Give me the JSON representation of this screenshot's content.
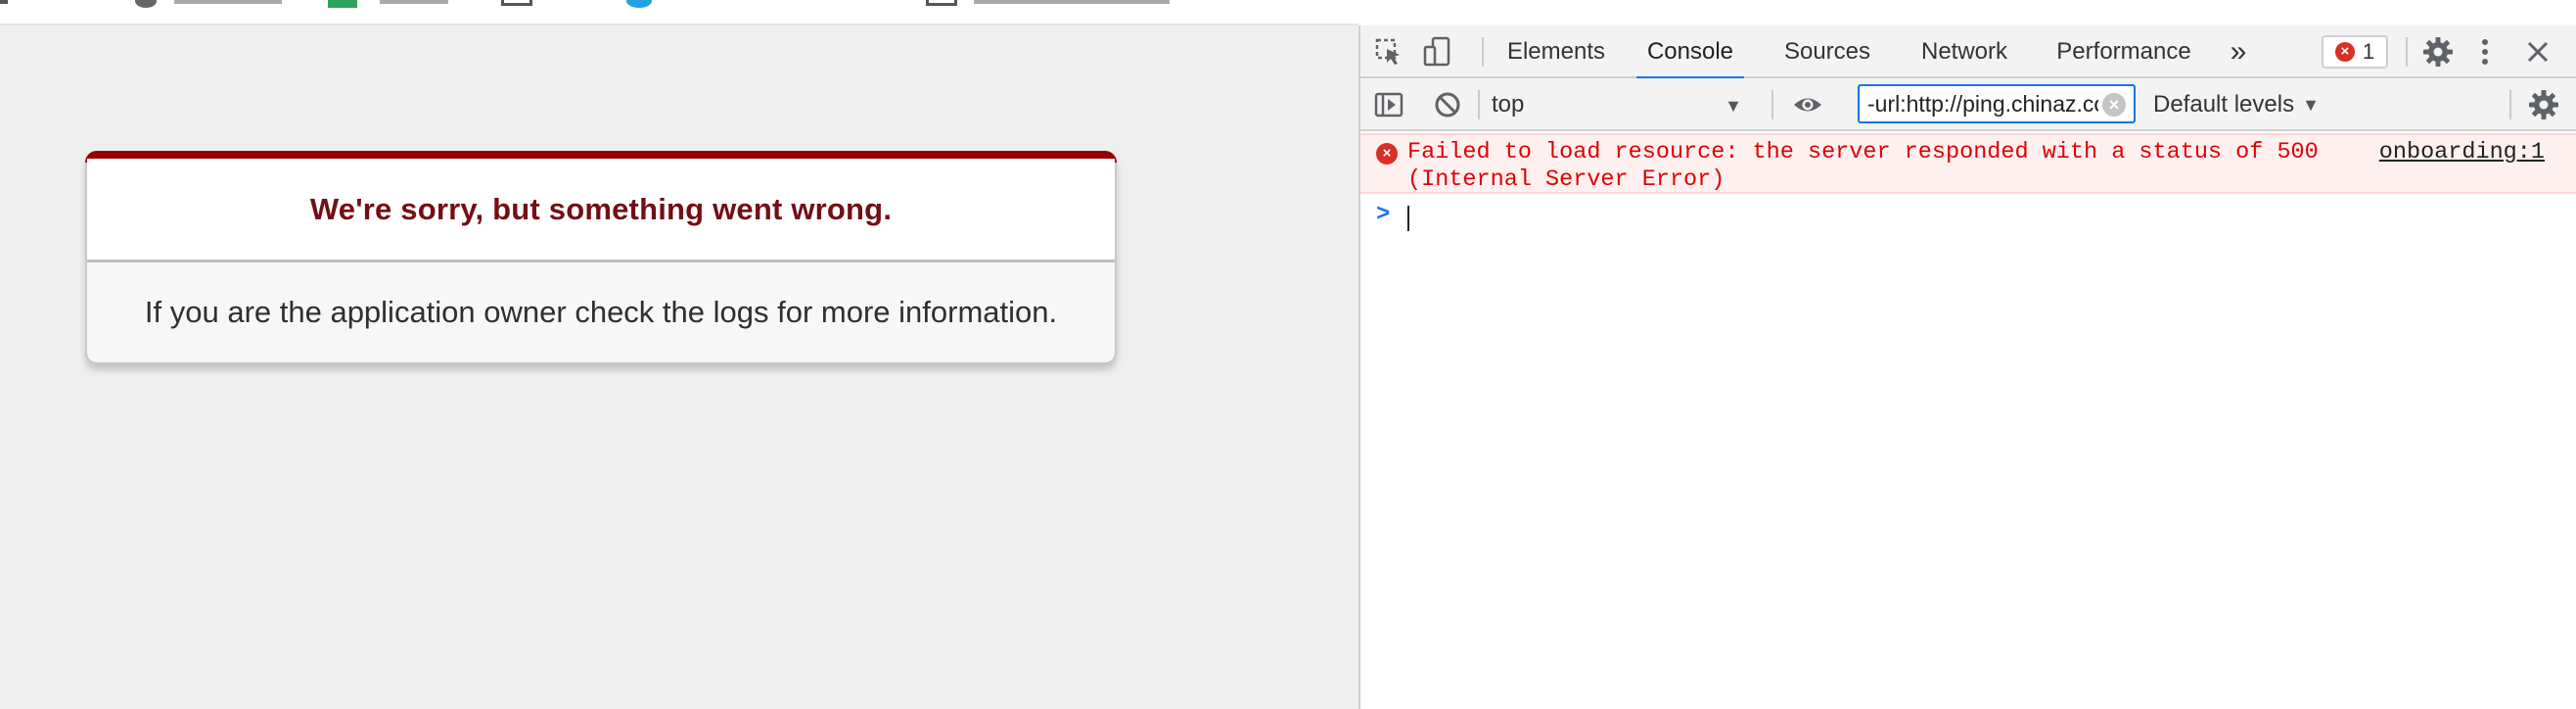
{
  "page": {
    "error_title": "We're sorry, but something went wrong.",
    "error_message": "If you are the application owner check the logs for more information."
  },
  "devtools": {
    "tabs": [
      {
        "label": "Elements"
      },
      {
        "label": "Console"
      },
      {
        "label": "Sources"
      },
      {
        "label": "Network"
      },
      {
        "label": "Performance"
      }
    ],
    "more_tabs_label": "»",
    "error_count": "1",
    "context": "top",
    "filter_value": "-url:http://ping.chinaz.com",
    "levels_label": "Default levels",
    "console": {
      "error_text": "Failed to load resource: the server responded with a status of 500 (Internal Server Error)",
      "error_source": "onboarding:1",
      "prompt_symbol": ">"
    },
    "icons": {
      "inspect": "inspect-element-icon",
      "device": "device-toolbar-icon",
      "settings": "gear-icon",
      "menu": "kebab-menu-icon",
      "close": "close-icon",
      "sidebar": "sidebar-toggle-icon",
      "clear": "clear-console-icon",
      "eye": "live-expression-icon"
    },
    "colors": {
      "accent": "#1a73e8",
      "error": "#e00000",
      "error_bg": "#fff0f0"
    }
  }
}
